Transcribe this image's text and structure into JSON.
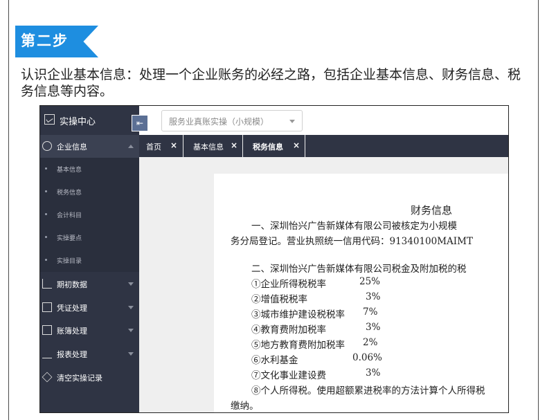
{
  "step": {
    "label": "第二步"
  },
  "intro": {
    "text": "认识企业基本信息：处理一个企业账务的必经之路，包括企业基本信息、财务信息、税务信息等内容。"
  },
  "sidebar": {
    "brand": "实操中心",
    "items": [
      {
        "label": "企业信息"
      },
      {
        "label": "期初数据"
      },
      {
        "label": "凭证处理"
      },
      {
        "label": "账簿处理"
      },
      {
        "label": "报表处理"
      },
      {
        "label": "清空实操记录"
      }
    ],
    "subitems": [
      "基本信息",
      "税务信息",
      "会计科目",
      "实操要点",
      "实操目录"
    ]
  },
  "topbar": {
    "select_value": "服务业真账实操（小规模）"
  },
  "tabs": [
    {
      "label": "首页",
      "close": "×"
    },
    {
      "label": "基本信息",
      "close": "×"
    },
    {
      "label": "税务信息",
      "close": "×"
    }
  ],
  "doc": {
    "title": "财务信息",
    "p1a": "一、深圳怡兴广告新媒体有限公司被核定为小规模",
    "p1b": "务分局登记。营业执照统一信用代码：91340100MAIMT",
    "p2": "二、深圳怡兴广告新媒体有限公司税金及附加税的税",
    "rates": [
      {
        "name": "①企业所得税税率",
        "value": "25%"
      },
      {
        "name": "②增值税税率",
        "value": "3%"
      },
      {
        "name": "③城市维护建设税税率",
        "value": "7%"
      },
      {
        "name": "④教育费附加税率",
        "value": "3%"
      },
      {
        "name": "⑤地方教育费附加税率",
        "value": "2%"
      },
      {
        "name": "⑥水利基金",
        "value": "0.06%"
      },
      {
        "name": "⑦文化事业建设费",
        "value": "3%"
      }
    ],
    "p8a": "⑧个人所得税。使用超额累进税率的方法计算个人所得税",
    "p8b": "缴纳。"
  }
}
